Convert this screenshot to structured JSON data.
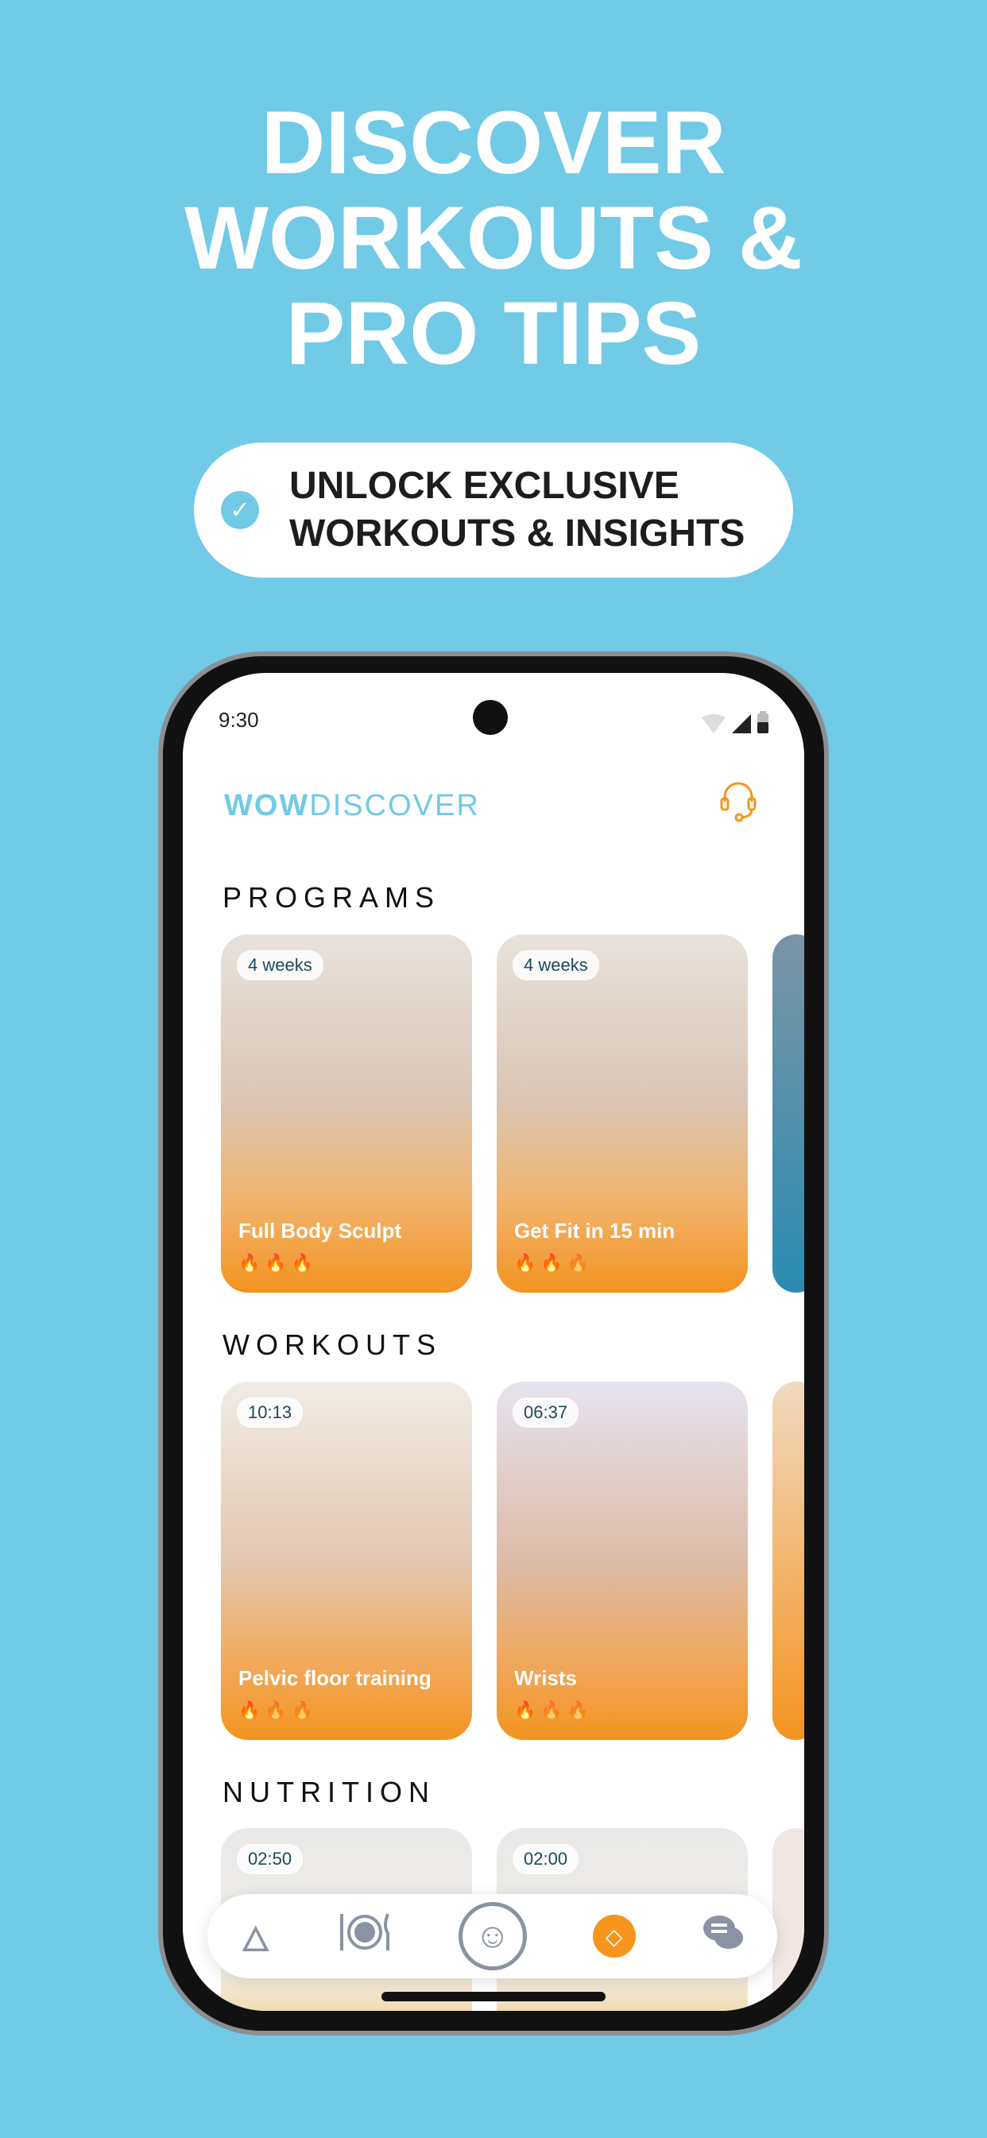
{
  "headline": [
    "DISCOVER",
    "WORKOUTS &",
    "PRO TIPS"
  ],
  "pill": {
    "line1": "UNLOCK EXCLUSIVE",
    "line2": "WORKOUTS & INSIGHTS",
    "icon": "check-circle-icon"
  },
  "status": {
    "time": "9:30"
  },
  "app": {
    "logo_bold": "WOW",
    "logo_light": "DISCOVER",
    "accent": "#f7941d",
    "brand": "#71cae6"
  },
  "sections": {
    "programs": "PROGRAMS",
    "workouts": "WORKOUTS",
    "nutrition": "NUTRITION"
  },
  "programs": [
    {
      "badge": "4 weeks",
      "title": "Full Body Sculpt",
      "intensity": 3
    },
    {
      "badge": "4 weeks",
      "title": "Get Fit in 15 min",
      "intensity": 2
    }
  ],
  "workouts": [
    {
      "badge": "10:13",
      "title": "Pelvic floor training",
      "intensity": 1
    },
    {
      "badge": "06:37",
      "title": "Wrists",
      "intensity": 1
    }
  ],
  "nutrition": [
    {
      "badge": "02:50"
    },
    {
      "badge": "02:00"
    }
  ],
  "nav": [
    "flame-icon",
    "meal-icon",
    "profile-avatar-icon",
    "discover-compass-icon",
    "chat-icon"
  ]
}
